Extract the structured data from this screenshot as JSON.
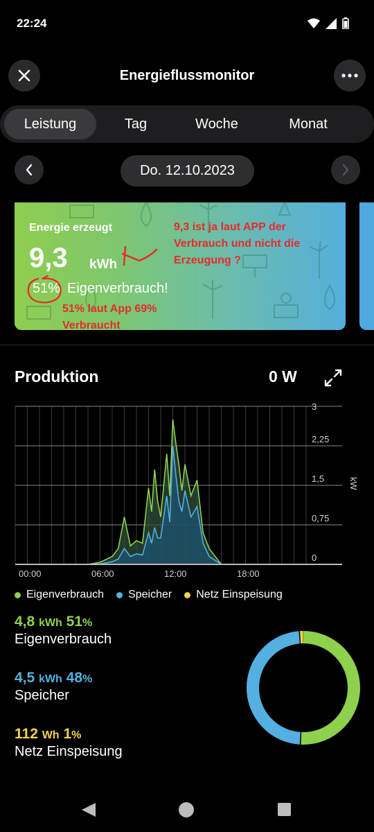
{
  "status_bar": {
    "time": "22:24"
  },
  "header": {
    "title": "Energieflussmonitor"
  },
  "tabs": [
    {
      "label": "Leistung",
      "active": true
    },
    {
      "label": "Tag",
      "active": false
    },
    {
      "label": "Woche",
      "active": false
    },
    {
      "label": "Monat",
      "active": false
    }
  ],
  "date": {
    "label": "Do. 12.10.2023"
  },
  "card": {
    "label": "Energie erzeugt",
    "value": "9,3",
    "unit": "kWh",
    "percent": "51%",
    "subtitle": "Eigenverbrauch!"
  },
  "annotations": {
    "top": [
      "9,3 ist ja laut APP der",
      "Verbrauch und nicht die",
      "Erzeugung ?"
    ],
    "bottom": [
      "51% laut App 69%",
      "Verbraucht"
    ]
  },
  "production": {
    "title": "Produktion",
    "current_value": "0 W"
  },
  "chart_data": {
    "type": "area",
    "xlabel": "",
    "ylabel": "kW",
    "x_ticks": [
      "00:00",
      "06:00",
      "12:00",
      "18:00"
    ],
    "y_ticks": [
      "3",
      "2,25",
      "1,5",
      "0,75",
      "0"
    ],
    "ylim": [
      0,
      3
    ],
    "x_hours": [
      0,
      6,
      7,
      8,
      8.5,
      9,
      9.5,
      10,
      10.5,
      11,
      11.25,
      11.5,
      11.75,
      12,
      12.25,
      12.5,
      12.75,
      13,
      13.25,
      13.5,
      13.75,
      14,
      14.5,
      15,
      15.5,
      16,
      17,
      24
    ],
    "series": [
      {
        "name": "Eigenverbrauch",
        "color": "#8ed14d",
        "values": [
          0,
          0,
          0.04,
          0.15,
          0.3,
          0.9,
          0.35,
          0.45,
          0.4,
          1.45,
          1.0,
          1.8,
          1.2,
          0.9,
          1.5,
          2.1,
          1.3,
          2.75,
          2.3,
          1.9,
          1.4,
          1.9,
          1.3,
          1.6,
          0.6,
          0.3,
          0,
          0
        ]
      },
      {
        "name": "Speicher",
        "color": "#53b0e0",
        "values": [
          0,
          0,
          0.01,
          0.05,
          0.1,
          0.3,
          0.15,
          0.2,
          0.18,
          0.6,
          0.4,
          0.7,
          0.5,
          0.5,
          0.9,
          1.3,
          0.8,
          2.25,
          1.7,
          1.2,
          1.0,
          1.4,
          0.9,
          1.1,
          0.4,
          0.15,
          0,
          0
        ]
      },
      {
        "name": "Netz Einspeisung",
        "color": "#f3d44c",
        "values": [
          0,
          0,
          0,
          0,
          0,
          0,
          0,
          0,
          0,
          0,
          0,
          0,
          0,
          0,
          0,
          0,
          0,
          0,
          0,
          0,
          0,
          0,
          0,
          0,
          0,
          0,
          0,
          0
        ]
      }
    ],
    "legend_position": "bottom",
    "grid": true
  },
  "legend": [
    {
      "label": "Eigenverbrauch",
      "color": "#8ed14d"
    },
    {
      "label": "Speicher",
      "color": "#53b0e0"
    },
    {
      "label": "Netz Einspeisung",
      "color": "#f3d44c"
    }
  ],
  "stats": [
    {
      "value": "4,8",
      "unit": "kWh",
      "percent": "51",
      "percent_sign": "%",
      "name": "Eigenverbrauch",
      "color": "#8ed14d"
    },
    {
      "value": "4,5",
      "unit": "kWh",
      "percent": "48",
      "percent_sign": "%",
      "name": "Speicher",
      "color": "#53b0e0"
    },
    {
      "value": "112",
      "unit": "Wh",
      "percent": "1",
      "percent_sign": "%",
      "name": "Netz Einspeisung",
      "color": "#f3d44c"
    }
  ],
  "donut": {
    "slices": [
      {
        "name": "Eigenverbrauch",
        "fraction": 0.51,
        "color": "#8ed14d"
      },
      {
        "name": "Speicher",
        "fraction": 0.48,
        "color": "#53b0e0"
      },
      {
        "name": "Netz Einspeisung",
        "fraction": 0.012,
        "color": "#f3d44c"
      }
    ]
  }
}
